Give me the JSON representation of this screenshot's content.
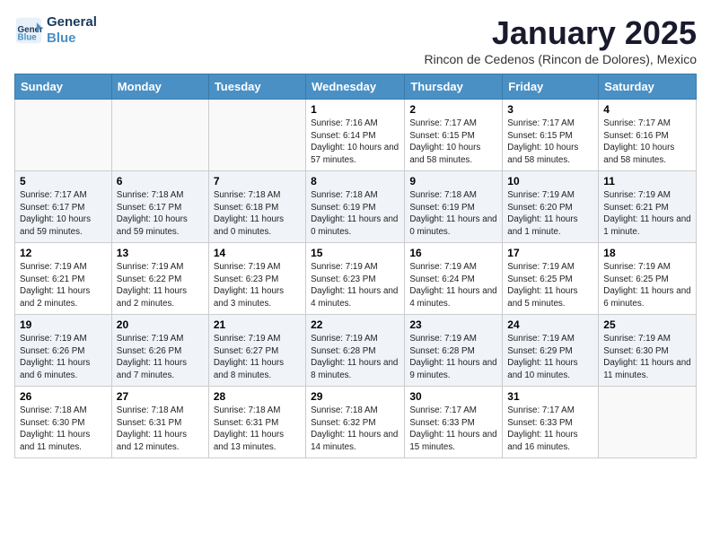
{
  "logo": {
    "line1": "General",
    "line2": "Blue"
  },
  "title": "January 2025",
  "subtitle": "Rincon de Cedenos (Rincon de Dolores), Mexico",
  "days_of_week": [
    "Sunday",
    "Monday",
    "Tuesday",
    "Wednesday",
    "Thursday",
    "Friday",
    "Saturday"
  ],
  "weeks": [
    [
      {
        "day": "",
        "info": ""
      },
      {
        "day": "",
        "info": ""
      },
      {
        "day": "",
        "info": ""
      },
      {
        "day": "1",
        "info": "Sunrise: 7:16 AM\nSunset: 6:14 PM\nDaylight: 10 hours and 57 minutes."
      },
      {
        "day": "2",
        "info": "Sunrise: 7:17 AM\nSunset: 6:15 PM\nDaylight: 10 hours and 58 minutes."
      },
      {
        "day": "3",
        "info": "Sunrise: 7:17 AM\nSunset: 6:15 PM\nDaylight: 10 hours and 58 minutes."
      },
      {
        "day": "4",
        "info": "Sunrise: 7:17 AM\nSunset: 6:16 PM\nDaylight: 10 hours and 58 minutes."
      }
    ],
    [
      {
        "day": "5",
        "info": "Sunrise: 7:17 AM\nSunset: 6:17 PM\nDaylight: 10 hours and 59 minutes."
      },
      {
        "day": "6",
        "info": "Sunrise: 7:18 AM\nSunset: 6:17 PM\nDaylight: 10 hours and 59 minutes."
      },
      {
        "day": "7",
        "info": "Sunrise: 7:18 AM\nSunset: 6:18 PM\nDaylight: 11 hours and 0 minutes."
      },
      {
        "day": "8",
        "info": "Sunrise: 7:18 AM\nSunset: 6:19 PM\nDaylight: 11 hours and 0 minutes."
      },
      {
        "day": "9",
        "info": "Sunrise: 7:18 AM\nSunset: 6:19 PM\nDaylight: 11 hours and 0 minutes."
      },
      {
        "day": "10",
        "info": "Sunrise: 7:19 AM\nSunset: 6:20 PM\nDaylight: 11 hours and 1 minute."
      },
      {
        "day": "11",
        "info": "Sunrise: 7:19 AM\nSunset: 6:21 PM\nDaylight: 11 hours and 1 minute."
      }
    ],
    [
      {
        "day": "12",
        "info": "Sunrise: 7:19 AM\nSunset: 6:21 PM\nDaylight: 11 hours and 2 minutes."
      },
      {
        "day": "13",
        "info": "Sunrise: 7:19 AM\nSunset: 6:22 PM\nDaylight: 11 hours and 2 minutes."
      },
      {
        "day": "14",
        "info": "Sunrise: 7:19 AM\nSunset: 6:23 PM\nDaylight: 11 hours and 3 minutes."
      },
      {
        "day": "15",
        "info": "Sunrise: 7:19 AM\nSunset: 6:23 PM\nDaylight: 11 hours and 4 minutes."
      },
      {
        "day": "16",
        "info": "Sunrise: 7:19 AM\nSunset: 6:24 PM\nDaylight: 11 hours and 4 minutes."
      },
      {
        "day": "17",
        "info": "Sunrise: 7:19 AM\nSunset: 6:25 PM\nDaylight: 11 hours and 5 minutes."
      },
      {
        "day": "18",
        "info": "Sunrise: 7:19 AM\nSunset: 6:25 PM\nDaylight: 11 hours and 6 minutes."
      }
    ],
    [
      {
        "day": "19",
        "info": "Sunrise: 7:19 AM\nSunset: 6:26 PM\nDaylight: 11 hours and 6 minutes."
      },
      {
        "day": "20",
        "info": "Sunrise: 7:19 AM\nSunset: 6:26 PM\nDaylight: 11 hours and 7 minutes."
      },
      {
        "day": "21",
        "info": "Sunrise: 7:19 AM\nSunset: 6:27 PM\nDaylight: 11 hours and 8 minutes."
      },
      {
        "day": "22",
        "info": "Sunrise: 7:19 AM\nSunset: 6:28 PM\nDaylight: 11 hours and 8 minutes."
      },
      {
        "day": "23",
        "info": "Sunrise: 7:19 AM\nSunset: 6:28 PM\nDaylight: 11 hours and 9 minutes."
      },
      {
        "day": "24",
        "info": "Sunrise: 7:19 AM\nSunset: 6:29 PM\nDaylight: 11 hours and 10 minutes."
      },
      {
        "day": "25",
        "info": "Sunrise: 7:19 AM\nSunset: 6:30 PM\nDaylight: 11 hours and 11 minutes."
      }
    ],
    [
      {
        "day": "26",
        "info": "Sunrise: 7:18 AM\nSunset: 6:30 PM\nDaylight: 11 hours and 11 minutes."
      },
      {
        "day": "27",
        "info": "Sunrise: 7:18 AM\nSunset: 6:31 PM\nDaylight: 11 hours and 12 minutes."
      },
      {
        "day": "28",
        "info": "Sunrise: 7:18 AM\nSunset: 6:31 PM\nDaylight: 11 hours and 13 minutes."
      },
      {
        "day": "29",
        "info": "Sunrise: 7:18 AM\nSunset: 6:32 PM\nDaylight: 11 hours and 14 minutes."
      },
      {
        "day": "30",
        "info": "Sunrise: 7:17 AM\nSunset: 6:33 PM\nDaylight: 11 hours and 15 minutes."
      },
      {
        "day": "31",
        "info": "Sunrise: 7:17 AM\nSunset: 6:33 PM\nDaylight: 11 hours and 16 minutes."
      },
      {
        "day": "",
        "info": ""
      }
    ]
  ]
}
